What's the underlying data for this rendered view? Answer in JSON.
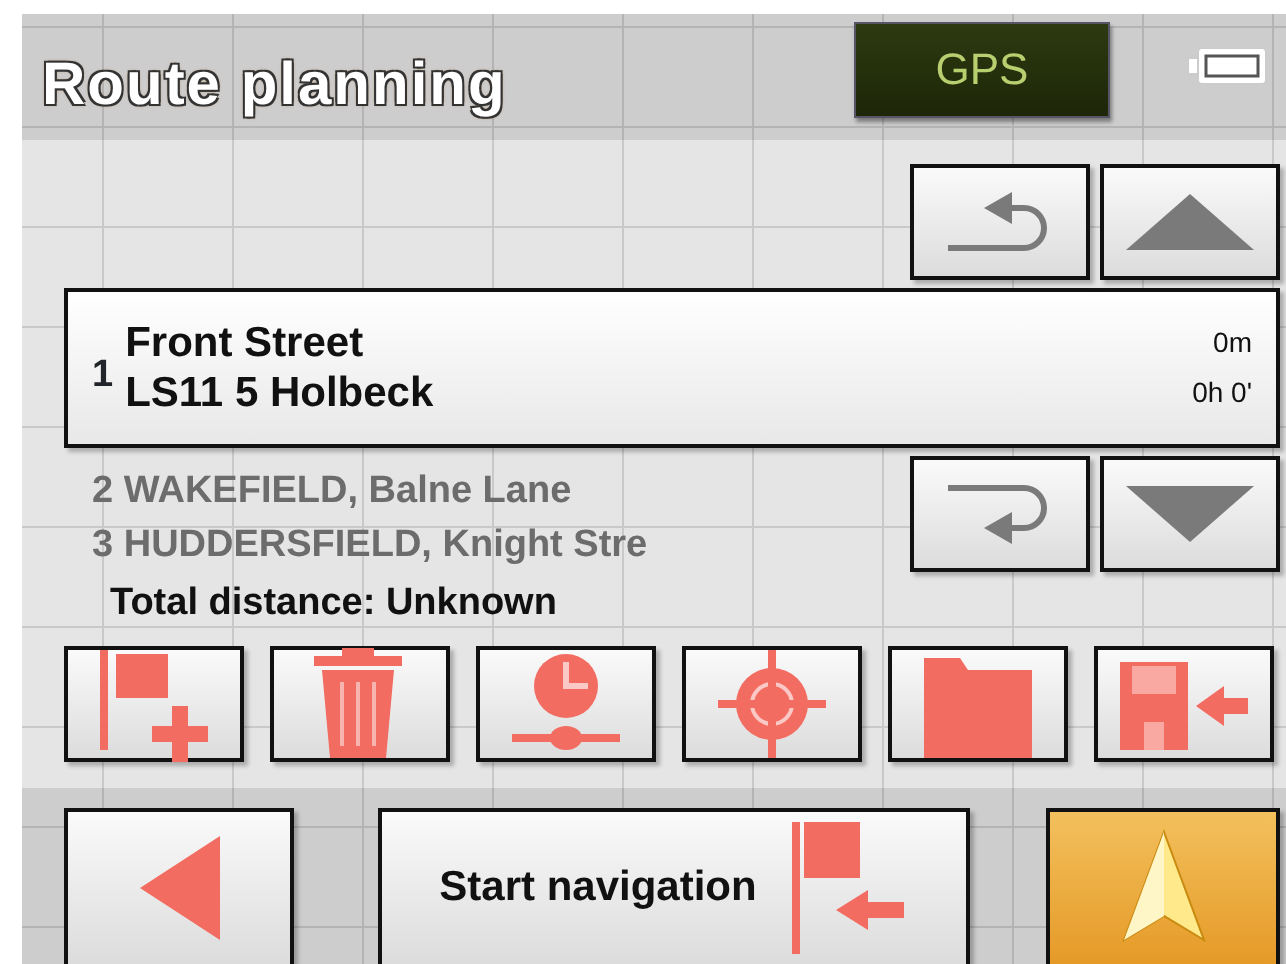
{
  "header": {
    "title": "Route planning",
    "gps_label": "GPS"
  },
  "destinations": [
    {
      "number": "1",
      "name": "Front Street",
      "place": "LS11 5 Holbeck",
      "distance": "0m",
      "time": "0h 0'",
      "selected": true
    },
    {
      "number": "2",
      "name": "WAKEFIELD, Balne Lane",
      "selected": false
    },
    {
      "number": "3",
      "name": "HUDDERSFIELD, Knight Stre",
      "selected": false
    }
  ],
  "total_distance": "Total distance: Unknown",
  "tools": [
    {
      "kind": "add-flag"
    },
    {
      "kind": "delete"
    },
    {
      "kind": "time"
    },
    {
      "kind": "target"
    },
    {
      "kind": "folder"
    },
    {
      "kind": "save"
    }
  ],
  "bottom": {
    "start_label": "Start navigation"
  }
}
